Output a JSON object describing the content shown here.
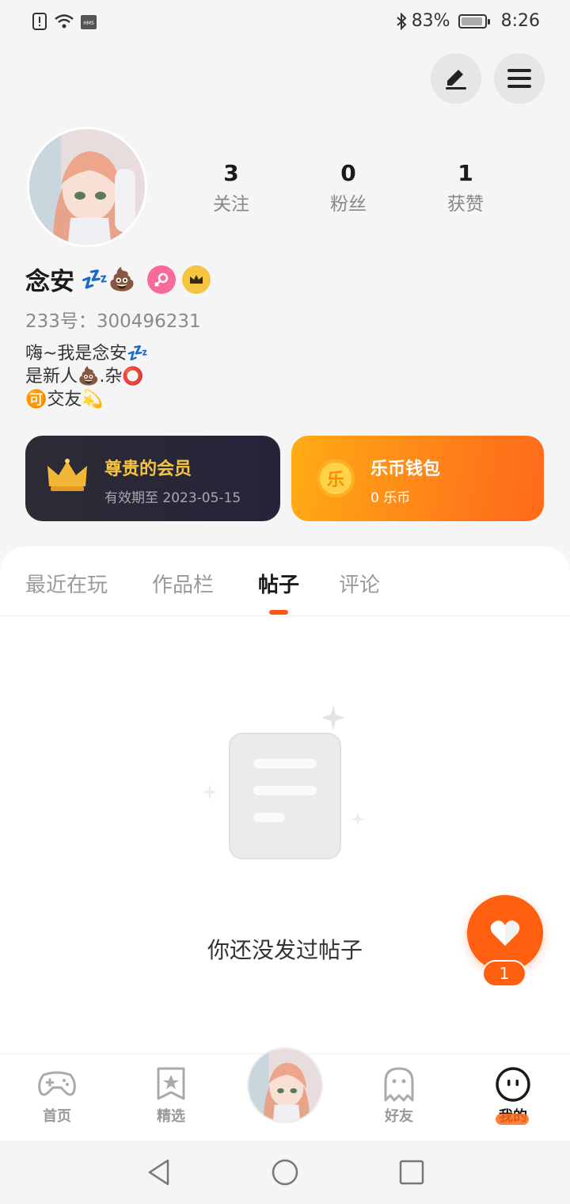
{
  "status_bar": {
    "battery": "83%",
    "time": "8:26"
  },
  "profile": {
    "stats": [
      {
        "value": "3",
        "label": "关注"
      },
      {
        "value": "0",
        "label": "粉丝"
      },
      {
        "value": "1",
        "label": "获赞"
      }
    ],
    "name": "念安",
    "name_emoji": "💤💩",
    "uid": "233号：300496231",
    "bio": [
      "嗨~我是念安💤",
      "是新人💩.杂⭕",
      "🉑交友💫"
    ]
  },
  "cards": {
    "vip_title": "尊贵的会员",
    "vip_sub": "有效期至 2023-05-15",
    "coin_title": "乐币钱包",
    "coin_sub": "0 乐币",
    "coin_glyph": "乐"
  },
  "tabs": [
    {
      "label": "最近在玩"
    },
    {
      "label": "作品栏"
    },
    {
      "label": "帖子"
    },
    {
      "label": "评论"
    }
  ],
  "empty_text": "你还没发过帖子",
  "like_count": "1",
  "bottom_nav": [
    {
      "label": "首页"
    },
    {
      "label": "精选"
    },
    {
      "label": "好友"
    },
    {
      "label": "我的"
    }
  ],
  "colors": {
    "accent": "#ff5f0f",
    "vip_gold": "#f5c542",
    "gender_pink": "#f76a9a"
  }
}
